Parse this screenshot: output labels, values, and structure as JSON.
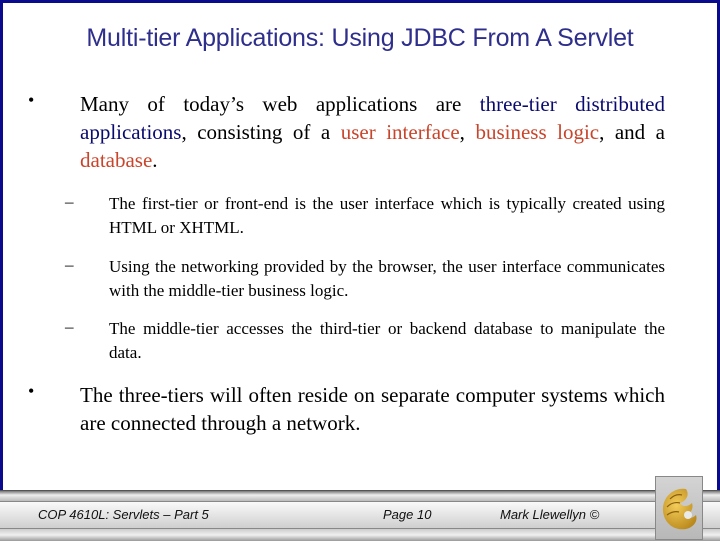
{
  "slide": {
    "title": "Multi-tier Applications:  Using JDBC From A Servlet",
    "colors": {
      "border": "#0a0a8c",
      "title": "#2e2e8c",
      "highlight_blue": "#0a0a6e",
      "highlight_red": "#c8442a",
      "logo_gold": "#d4a52a"
    },
    "bullets": [
      {
        "marker": "•",
        "segments": [
          {
            "text": "Many of today’s web applications are ",
            "style": "normal"
          },
          {
            "text": "three-tier distributed applications",
            "style": "blue"
          },
          {
            "text": ", consisting of a ",
            "style": "normal"
          },
          {
            "text": "user interface",
            "style": "red"
          },
          {
            "text": ", ",
            "style": "normal"
          },
          {
            "text": "business logic",
            "style": "red"
          },
          {
            "text": ", and a ",
            "style": "normal"
          },
          {
            "text": "database",
            "style": "red"
          },
          {
            "text": ".",
            "style": "normal"
          }
        ],
        "sub_bullets": [
          {
            "marker": "–",
            "text": "The first-tier or front-end is the user interface which is typically created using HTML or XHTML."
          },
          {
            "marker": "–",
            "text": "Using the networking provided by the browser, the user interface communicates with the middle-tier business logic."
          },
          {
            "marker": "–",
            "text": "The middle-tier accesses the third-tier or backend database to manipulate the data."
          }
        ]
      },
      {
        "marker": "•",
        "text": "The three-tiers will often reside on separate computer systems which are connected through a network."
      }
    ]
  },
  "footer": {
    "course": "COP 4610L: Servlets – Part 5",
    "page": "Page 10",
    "author": "Mark Llewellyn ©",
    "logo": "pegasus-logo-icon"
  }
}
